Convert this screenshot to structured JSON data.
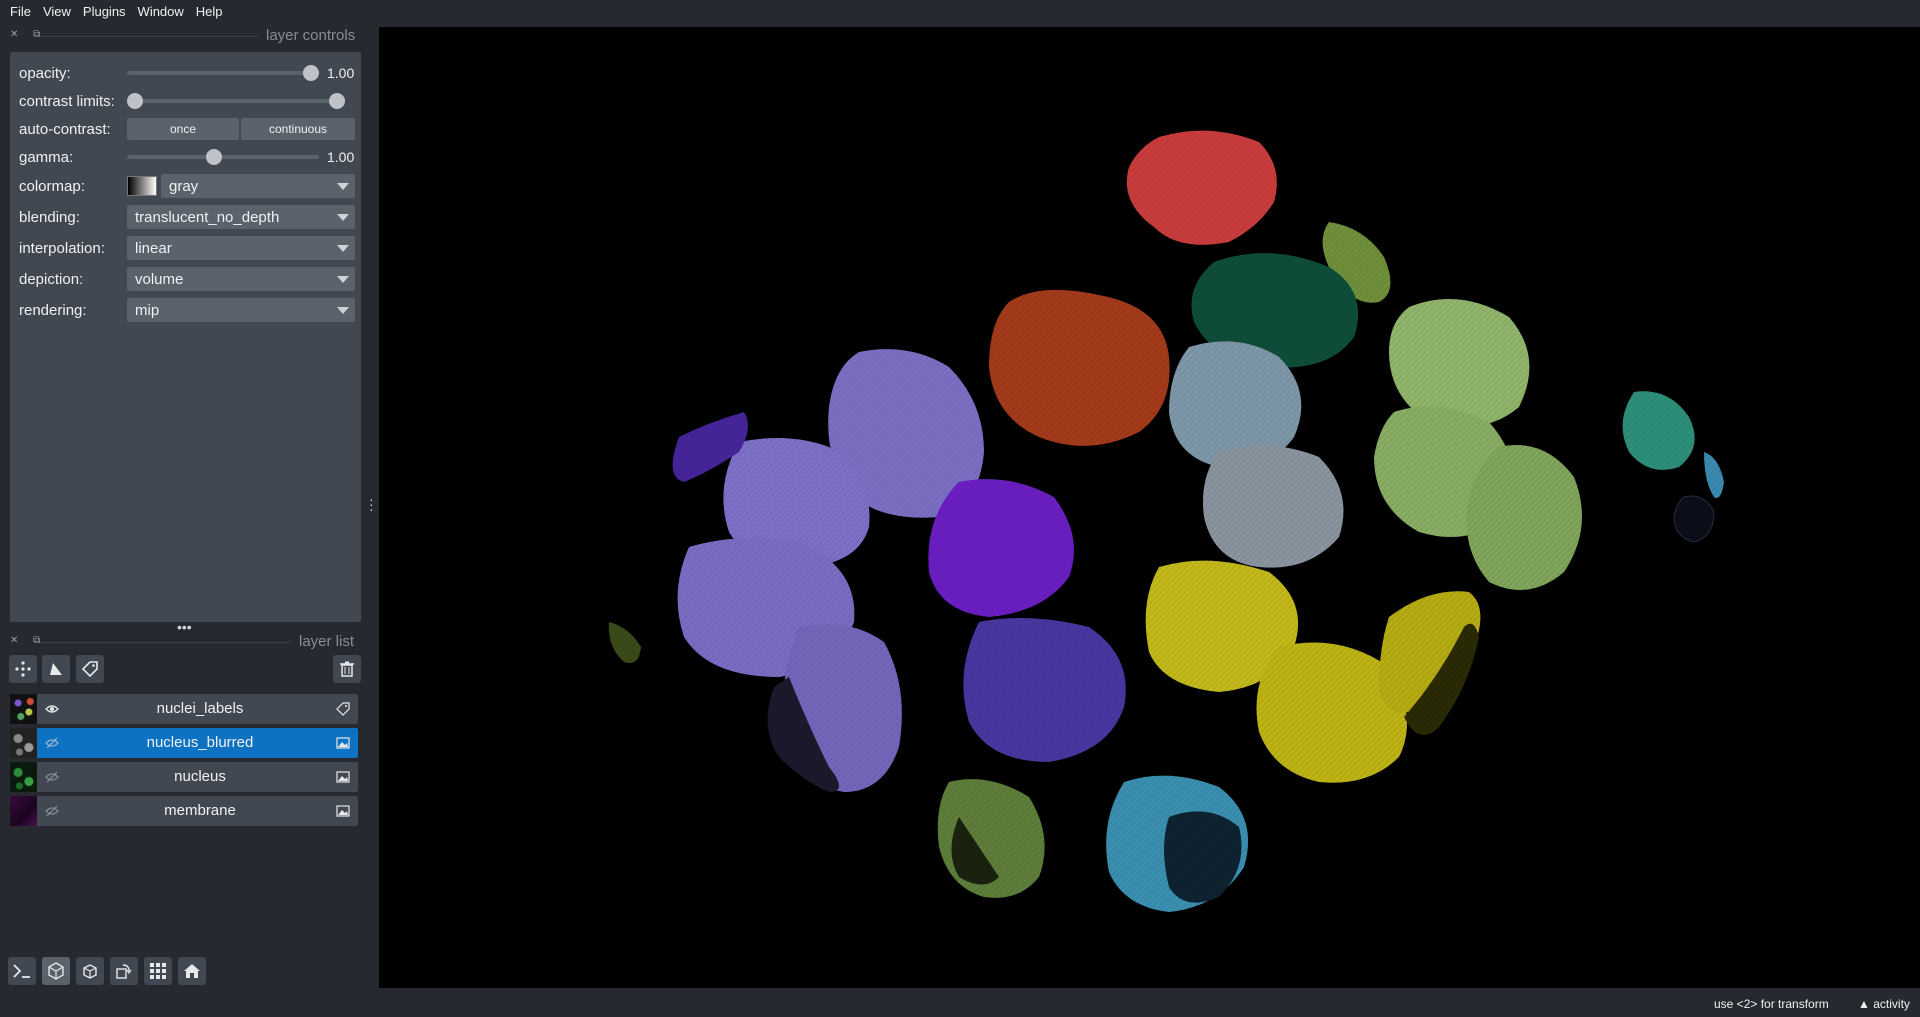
{
  "menu": [
    "File",
    "View",
    "Plugins",
    "Window",
    "Help"
  ],
  "layer_controls": {
    "title": "layer controls",
    "opacity": {
      "label": "opacity:",
      "value": "1.00",
      "level": 1.0
    },
    "contrast_limits": {
      "label": "contrast limits:",
      "low": 0.0,
      "high": 1.0
    },
    "auto_contrast": {
      "label": "auto-contrast:",
      "once": "once",
      "continuous": "continuous"
    },
    "gamma": {
      "label": "gamma:",
      "value": "1.00",
      "level": 0.45
    },
    "colormap": {
      "label": "colormap:",
      "value": "gray"
    },
    "blending": {
      "label": "blending:",
      "value": "translucent_no_depth"
    },
    "interpolation": {
      "label": "interpolation:",
      "value": "linear"
    },
    "depiction": {
      "label": "depiction:",
      "value": "volume"
    },
    "rendering": {
      "label": "rendering:",
      "value": "mip"
    }
  },
  "layer_list": {
    "title": "layer list",
    "layers": [
      {
        "name": "nuclei_labels",
        "visible": true,
        "selected": false,
        "type": "labels"
      },
      {
        "name": "nucleus_blurred",
        "visible": false,
        "selected": true,
        "type": "image"
      },
      {
        "name": "nucleus",
        "visible": false,
        "selected": false,
        "type": "image"
      },
      {
        "name": "membrane",
        "visible": false,
        "selected": false,
        "type": "image"
      }
    ]
  },
  "status": {
    "hint": "use <2> for transform",
    "activity": "activity"
  },
  "colors": {
    "background": "#262930",
    "panel": "#414851",
    "control": "#5a626c",
    "selection": "#0e72c3",
    "canvas": "#000000"
  }
}
